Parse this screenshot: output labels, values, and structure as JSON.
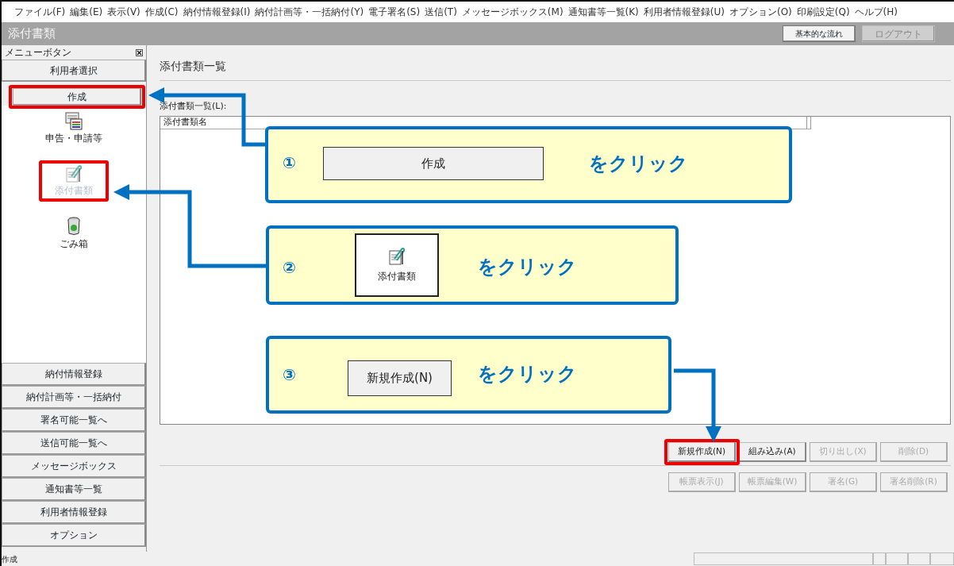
{
  "menu_bar": [
    "ファイル(F)",
    "編集(E)",
    "表示(V)",
    "作成(C)",
    "納付情報登録(I)",
    "納付計画等・一括納付(Y)",
    "電子署名(S)",
    "送信(T)",
    "メッセージボックス(M)",
    "通知書等一覧(K)",
    "利用者情報登録(U)",
    "オプション(O)",
    "印刷設定(Q)",
    "ヘルプ(H)"
  ],
  "title_bar": {
    "title": "添付書類",
    "buttons": [
      {
        "label": "基本的な流れ",
        "disabled": false
      },
      {
        "label": "ログアウト",
        "disabled": true
      }
    ]
  },
  "sidebar": {
    "header": "メニューボタン",
    "top_buttons": [
      "利用者選択",
      "作成"
    ],
    "icons": [
      {
        "label": "申告・申請等",
        "kind": "form",
        "disabled": false
      },
      {
        "label": "添付書類",
        "kind": "attachment",
        "disabled": true
      },
      {
        "label": "ごみ箱",
        "kind": "trash",
        "disabled": false
      }
    ],
    "bottom_buttons": [
      "納付情報登録",
      "納付計画等・一括納付",
      "署名可能一覧へ",
      "送信可能一覧へ",
      "メッセージボックス",
      "通知書等一覧",
      "利用者情報登録",
      "オプション"
    ]
  },
  "main": {
    "heading": "添付書類一覧",
    "list_label": "添付書類一覧(L):",
    "list": {
      "columns": [
        "添付書類名"
      ]
    },
    "button_rows": [
      [
        {
          "label": "新規作成(N)",
          "disabled": false
        },
        {
          "label": "組み込み(A)",
          "disabled": false
        },
        {
          "label": "切り出し(X)",
          "disabled": true
        },
        {
          "label": "削除(D)",
          "disabled": true
        }
      ],
      [
        {
          "label": "帳票表示(J)",
          "disabled": true
        },
        {
          "label": "帳票編集(W)",
          "disabled": true
        },
        {
          "label": "署名(G)",
          "disabled": true
        },
        {
          "label": "署名削除(R)",
          "disabled": true
        }
      ]
    ]
  },
  "status_bar": {
    "text": "作成"
  },
  "callouts": [
    {
      "number": "①",
      "kind": "button",
      "target": "作成",
      "text": "をクリック"
    },
    {
      "number": "②",
      "kind": "icon",
      "target": "添付書類",
      "text": "をクリック"
    },
    {
      "number": "③",
      "kind": "button",
      "target": "新規作成(N)",
      "text": "をクリック"
    }
  ]
}
